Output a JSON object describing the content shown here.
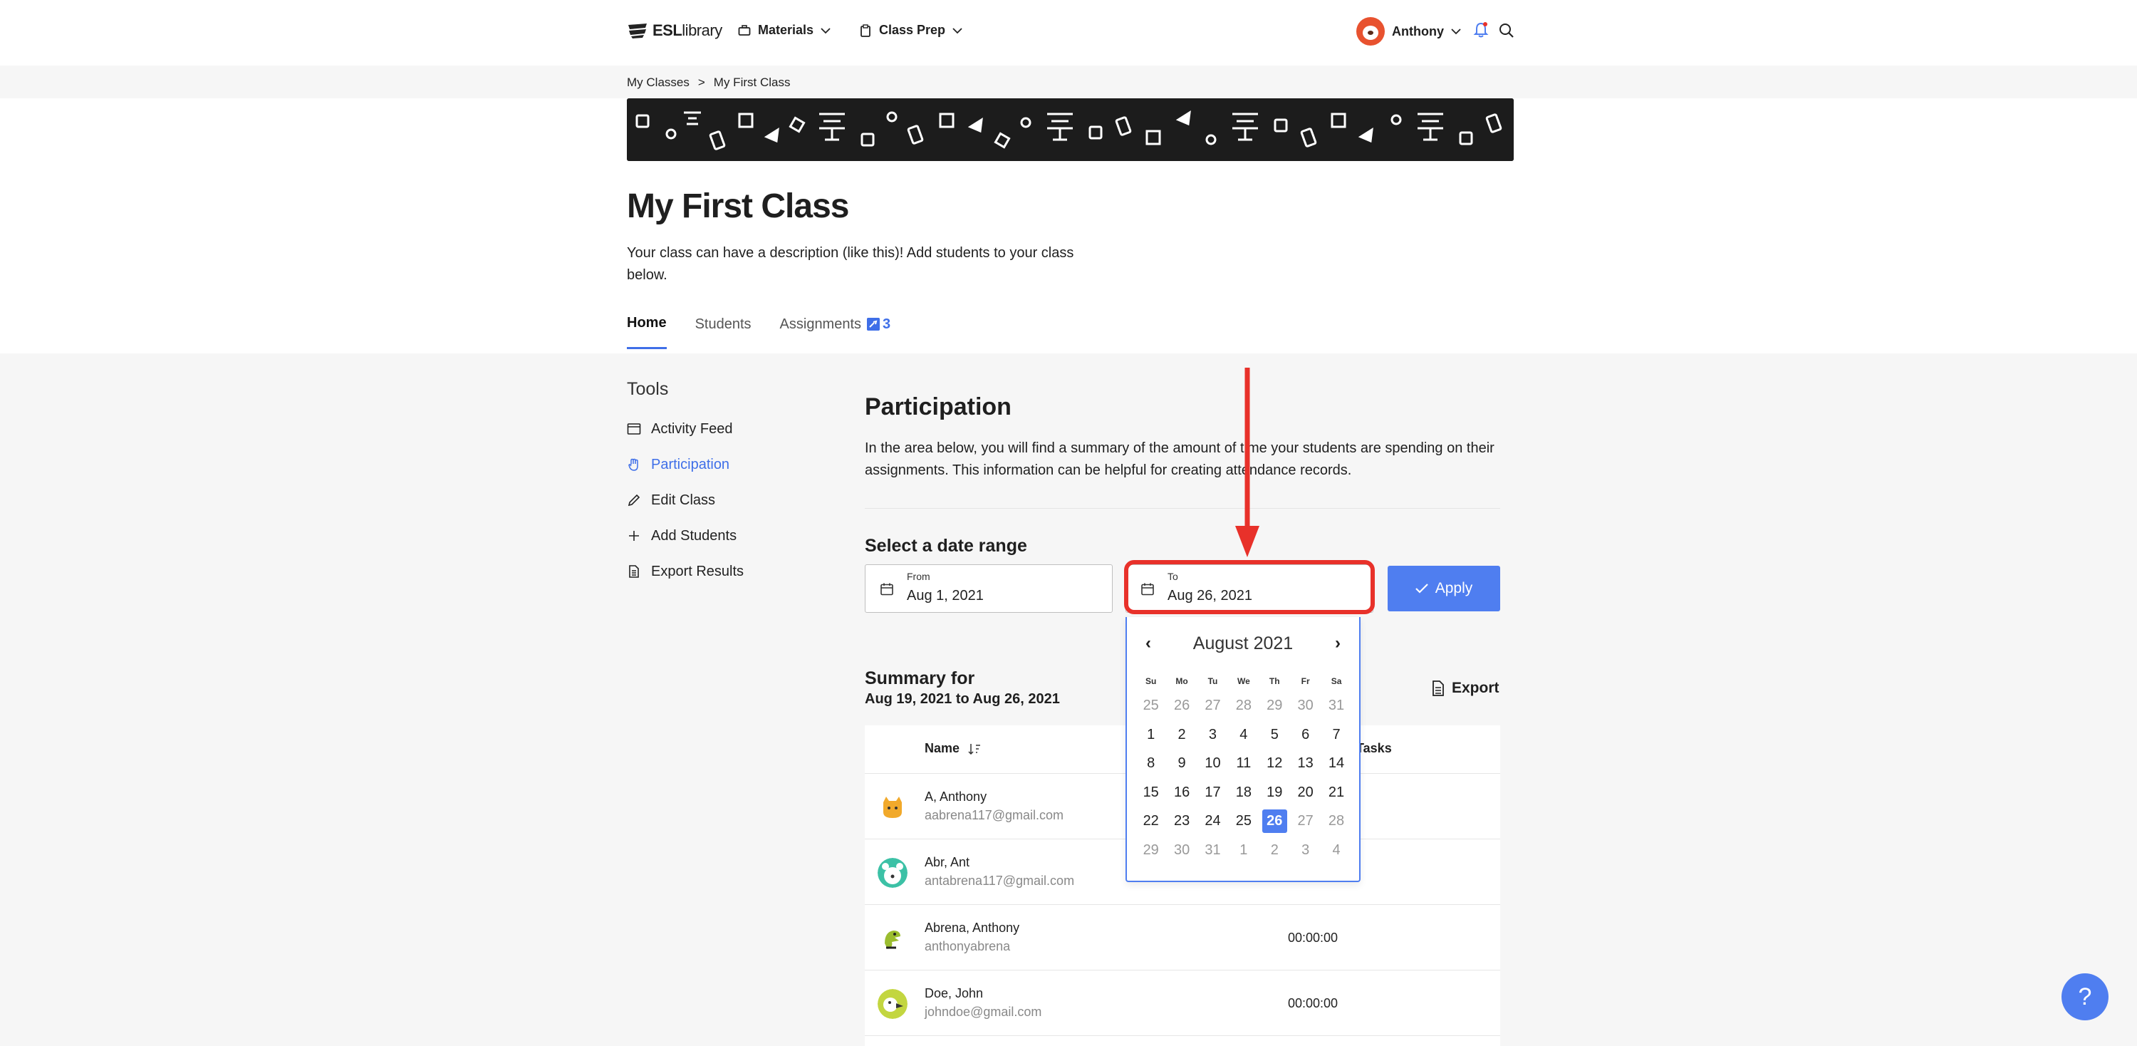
{
  "nav": {
    "logo_bold": "ESL",
    "logo_light": "library",
    "materials": "Materials",
    "class_prep": "Class Prep",
    "user_name": "Anthony"
  },
  "breadcrumb": {
    "root": "My Classes",
    "sep": ">",
    "current": "My First Class"
  },
  "class": {
    "title": "My First Class",
    "description": "Your class can have a description (like this)! Add students to your class below."
  },
  "tabs": {
    "home": "Home",
    "students": "Students",
    "assignments": "Assignments",
    "assignments_count": "3"
  },
  "tools": {
    "heading": "Tools",
    "items": [
      "Activity Feed",
      "Participation",
      "Edit Class",
      "Add Students",
      "Export Results"
    ]
  },
  "participation": {
    "title": "Participation",
    "intro": "In the area below, you will find a summary of the amount of time your students are spending on their assignments. This information can be helpful for creating attendance records.",
    "date_range_label": "Select a date range",
    "from_label": "From",
    "from_value": "Aug 1, 2021",
    "to_label": "To",
    "to_value": "Aug 26, 2021",
    "apply": "Apply"
  },
  "summary": {
    "heading": "Summary for",
    "range": "Aug 19, 2021 to Aug 26, 2021",
    "export": "Export",
    "col_name": "Name",
    "col_tasks": "Tasks",
    "rows": [
      {
        "name": "A, Anthony",
        "email": "aabrena117@gmail.com",
        "time": ""
      },
      {
        "name": "Abr, Ant",
        "email": "antabrena117@gmail.com",
        "time": ""
      },
      {
        "name": "Abrena, Anthony",
        "email": "anthonyabrena",
        "time": "00:00:00"
      },
      {
        "name": "Doe, John",
        "email": "johndoe@gmail.com",
        "time": "00:00:00"
      }
    ]
  },
  "calendar": {
    "month": "August 2021",
    "prev": "‹",
    "next": "›",
    "weekdays": [
      "Su",
      "Mo",
      "Tu",
      "We",
      "Th",
      "Fr",
      "Sa"
    ],
    "days": [
      [
        "25",
        "26",
        "27",
        "28",
        "29",
        "30",
        "31"
      ],
      [
        "1",
        "2",
        "3",
        "4",
        "5",
        "6",
        "7"
      ],
      [
        "8",
        "9",
        "10",
        "11",
        "12",
        "13",
        "14"
      ],
      [
        "15",
        "16",
        "17",
        "18",
        "19",
        "20",
        "21"
      ],
      [
        "22",
        "23",
        "24",
        "25",
        "26",
        "27",
        "28"
      ],
      [
        "29",
        "30",
        "31",
        "1",
        "2",
        "3",
        "4"
      ]
    ],
    "selected": "26"
  },
  "help": "?",
  "colors": {
    "accent": "#4f7ef0",
    "highlight": "#e8312a"
  }
}
